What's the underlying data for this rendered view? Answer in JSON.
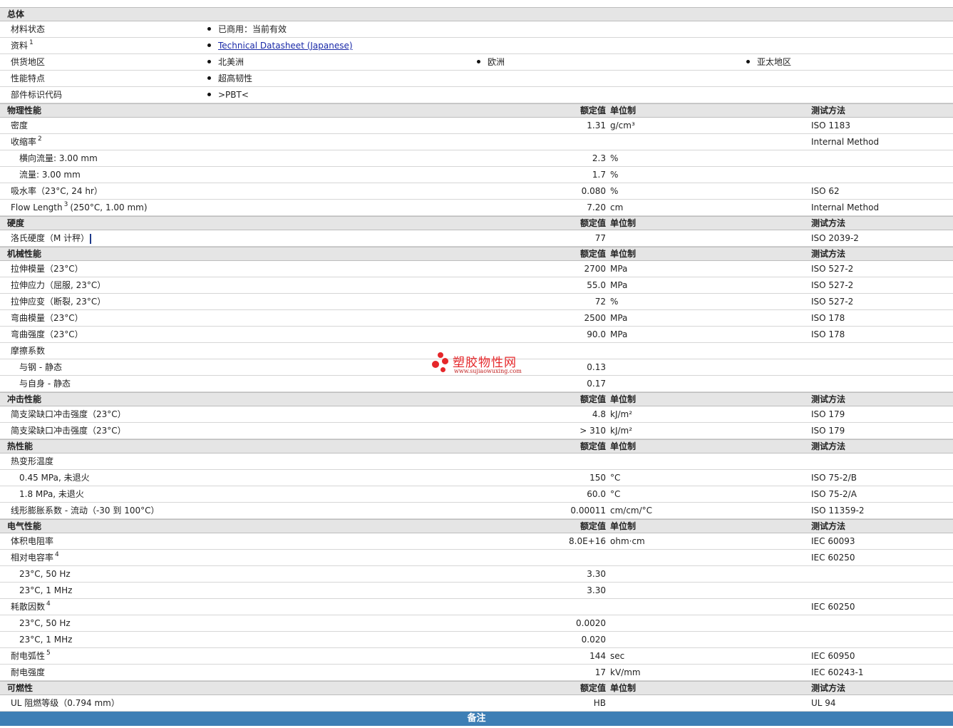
{
  "general": {
    "header": "总体",
    "status_label": "材料状态",
    "status_value": "已商用：当前有效",
    "datasheet_label": "资料",
    "datasheet_sup": "1",
    "datasheet_link": "Technical Datasheet (Japanese)",
    "supply_label": "供货地区",
    "supply_regions": [
      "北美洲",
      "欧洲",
      "亚太地区"
    ],
    "features_label": "性能特点",
    "features_value": "超高韧性",
    "marking_label": "部件标识代码",
    "marking_value": ">PBT<"
  },
  "col_headers": {
    "value": "额定值",
    "unit": "单位制",
    "test": "测试方法"
  },
  "physical": {
    "header": "物理性能",
    "rows": [
      {
        "label": "密度",
        "value": "1.31",
        "unit": "g/cm³",
        "test": "ISO 1183"
      },
      {
        "label": "收缩率",
        "sup": "2",
        "value": "",
        "unit": "",
        "test": "Internal Method"
      },
      {
        "label": "横向流量: 3.00 mm",
        "value": "2.3",
        "unit": "%",
        "test": ""
      },
      {
        "label": "流量: 3.00 mm",
        "value": "1.7",
        "unit": "%",
        "test": ""
      },
      {
        "label": "吸水率（23°C, 24 hr）",
        "value": "0.080",
        "unit": "%",
        "test": "ISO 62"
      },
      {
        "label": "Flow Length",
        "sup": "3",
        "label_suffix": "(250°C, 1.00 mm)",
        "value": "7.20",
        "unit": "cm",
        "test": "Internal Method"
      }
    ]
  },
  "hardness": {
    "header": "硬度",
    "rows": [
      {
        "label": "洛氏硬度（M 计秤）",
        "value": "77",
        "unit": "",
        "test": "ISO 2039-2"
      }
    ]
  },
  "mechanical": {
    "header": "机械性能",
    "rows": [
      {
        "label": "拉伸模量（23°C）",
        "value": "2700",
        "unit": "MPa",
        "test": "ISO 527-2"
      },
      {
        "label": "拉伸应力（屈服, 23°C）",
        "value": "55.0",
        "unit": "MPa",
        "test": "ISO 527-2"
      },
      {
        "label": "拉伸应变（断裂, 23°C）",
        "value": "72",
        "unit": "%",
        "test": "ISO 527-2"
      },
      {
        "label": "弯曲模量（23°C）",
        "value": "2500",
        "unit": "MPa",
        "test": "ISO 178"
      },
      {
        "label": "弯曲强度（23°C）",
        "value": "90.0",
        "unit": "MPa",
        "test": "ISO 178"
      },
      {
        "label": "摩擦系数",
        "value": "",
        "unit": "",
        "test": ""
      },
      {
        "label": "与钢 - 静态",
        "value": "0.13",
        "unit": "",
        "test": ""
      },
      {
        "label": "与自身 - 静态",
        "value": "0.17",
        "unit": "",
        "test": ""
      }
    ]
  },
  "impact": {
    "header": "冲击性能",
    "rows": [
      {
        "label": "简支梁缺口冲击强度（23°C）",
        "value": "4.8",
        "unit": "kJ/m²",
        "test": "ISO 179"
      },
      {
        "label": "简支梁缺口冲击强度（23°C）",
        "value": "> 310",
        "unit": "kJ/m²",
        "test": "ISO 179"
      }
    ]
  },
  "thermal": {
    "header": "热性能",
    "rows": [
      {
        "label": "热变形温度",
        "value": "",
        "unit": "",
        "test": ""
      },
      {
        "label": "0.45 MPa, 未退火",
        "value": "150",
        "unit": "°C",
        "test": "ISO 75-2/B"
      },
      {
        "label": "1.8 MPa, 未退火",
        "value": "60.0",
        "unit": "°C",
        "test": "ISO 75-2/A"
      },
      {
        "label": "线形膨胀系数 - 流动（-30 到 100°C）",
        "value": "0.00011",
        "unit": "cm/cm/°C",
        "test": "ISO 11359-2"
      }
    ]
  },
  "electrical": {
    "header": "电气性能",
    "rows": [
      {
        "label": "体积电阻率",
        "value": "8.0E+16",
        "unit": "ohm·cm",
        "test": "IEC 60093"
      },
      {
        "label": "相对电容率",
        "sup": "4",
        "value": "",
        "unit": "",
        "test": "IEC 60250"
      },
      {
        "label": "23°C, 50 Hz",
        "value": "3.30",
        "unit": "",
        "test": ""
      },
      {
        "label": "23°C, 1 MHz",
        "value": "3.30",
        "unit": "",
        "test": ""
      },
      {
        "label": "耗散因数",
        "sup": "4",
        "value": "",
        "unit": "",
        "test": "IEC 60250"
      },
      {
        "label": "23°C, 50 Hz",
        "value": "0.0020",
        "unit": "",
        "test": ""
      },
      {
        "label": "23°C, 1 MHz",
        "value": "0.020",
        "unit": "",
        "test": ""
      },
      {
        "label": "耐电弧性",
        "sup": "5",
        "value": "144",
        "unit": "sec",
        "test": "IEC 60950"
      },
      {
        "label": "耐电强度",
        "value": "17",
        "unit": "kV/mm",
        "test": "IEC 60243-1"
      }
    ]
  },
  "flammability": {
    "header": "可燃性",
    "rows": [
      {
        "label": "UL 阻燃等级（0.794 mm）",
        "value": "HB",
        "unit": "",
        "test": "UL 94"
      }
    ]
  },
  "notes_bar": "备注",
  "watermark": {
    "title": "塑胶物性网",
    "url": "www.sujiaowuxing.com"
  }
}
